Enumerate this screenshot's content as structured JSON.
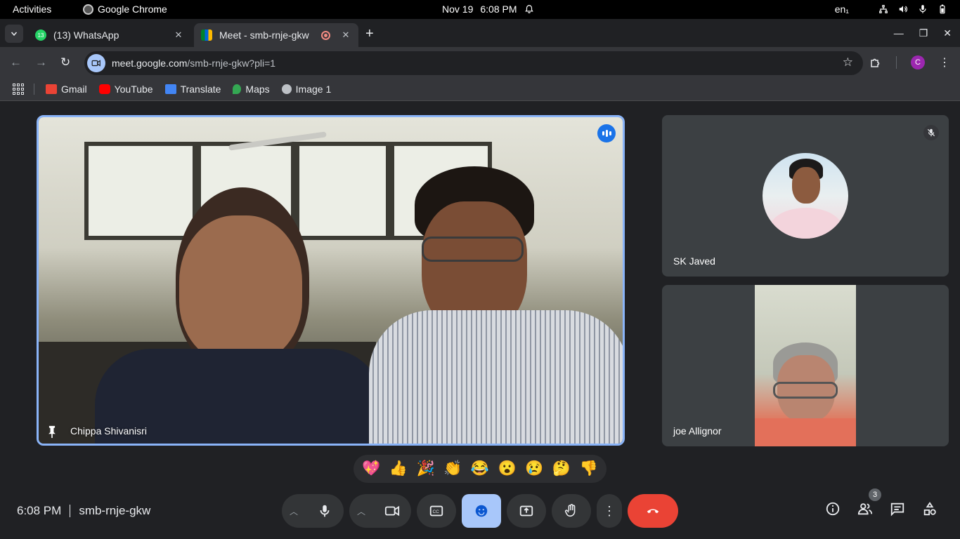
{
  "system_bar": {
    "activities": "Activities",
    "app_name": "Google Chrome",
    "date": "Nov 19",
    "time": "6:08 PM",
    "input_lang": "en₁"
  },
  "browser": {
    "tabs": [
      {
        "title": "(13) WhatsApp",
        "favicon": "whatsapp-icon",
        "badge": "13"
      },
      {
        "title": "Meet - smb-rnje-gkw",
        "favicon": "meet-icon",
        "recording": true
      }
    ],
    "url_host": "meet.google.com",
    "url_path": "/smb-rnje-gkw?pli=1",
    "profile_initial": "C",
    "bookmarks": [
      {
        "label": "Gmail",
        "icon": "gmail-icon",
        "color": "#ea4335"
      },
      {
        "label": "YouTube",
        "icon": "youtube-icon",
        "color": "#ff0000"
      },
      {
        "label": "Translate",
        "icon": "translate-icon",
        "color": "#4285f4"
      },
      {
        "label": "Maps",
        "icon": "maps-icon",
        "color": "#34a853"
      },
      {
        "label": "Image 1",
        "icon": "globe-icon",
        "color": "#bdc1c6"
      }
    ]
  },
  "meet": {
    "main_participant": "Chippa Shivanisri",
    "participants": [
      {
        "name": "SK Javed",
        "muted": true
      },
      {
        "name": "joe Allignor",
        "muted": false
      }
    ],
    "reactions": [
      "💖",
      "👍",
      "🎉",
      "👏",
      "😂",
      "😮",
      "😢",
      "🤔",
      "👎"
    ],
    "time": "6:08 PM",
    "meeting_code": "smb-rnje-gkw",
    "people_count": "3",
    "colors": {
      "accent": "#8ab4f8",
      "end_call": "#ea4335",
      "active_button": "#a8c7fa"
    }
  }
}
